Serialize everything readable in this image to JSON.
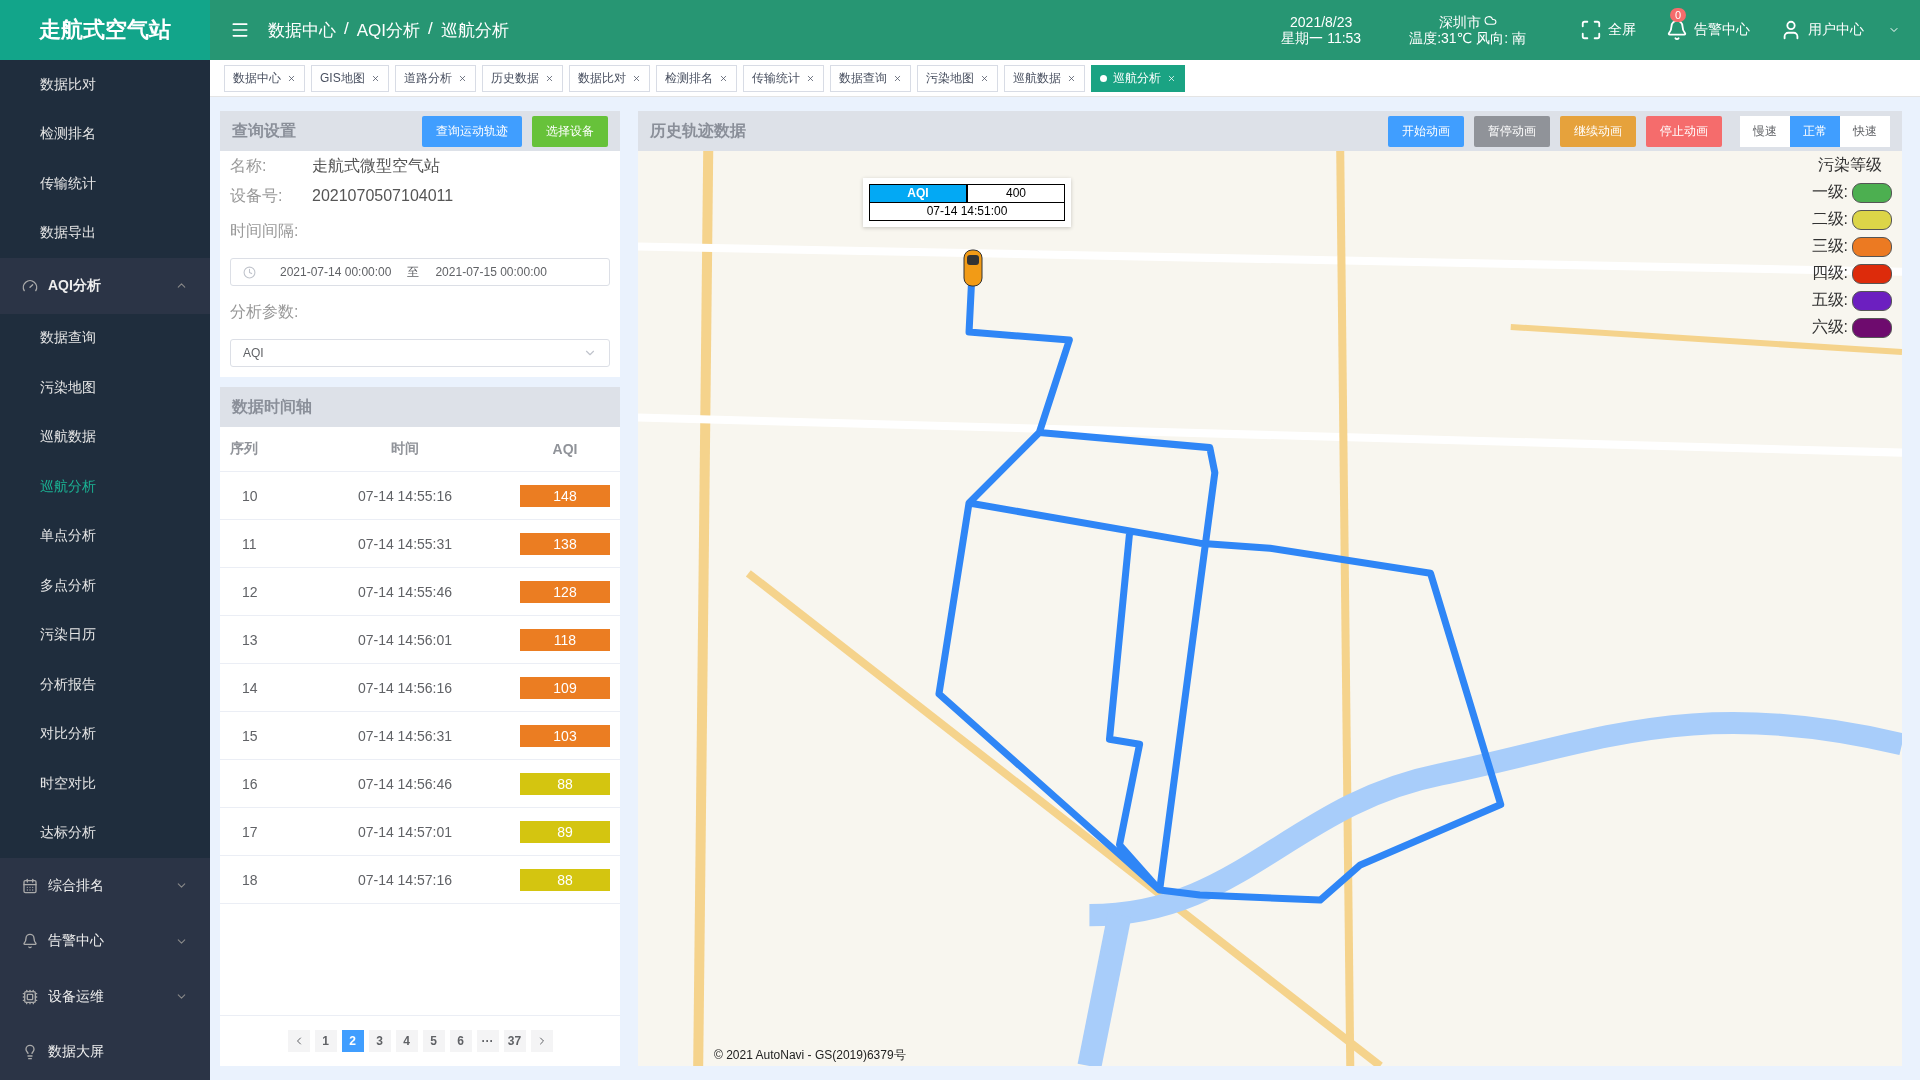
{
  "app_title": "走航式空气站",
  "breadcrumb": [
    {
      "label": "数据中心"
    },
    {
      "separator": "/",
      "label": "AQI分析"
    },
    {
      "separator": "/",
      "label": "巡航分析"
    }
  ],
  "datetime": {
    "date": "2021/8/23",
    "weekday_time": "星期一 11:53"
  },
  "weather": {
    "city": "深圳市",
    "detail": "温度:31℃ 风向: 南"
  },
  "header_actions": [
    {
      "kind": "fullscreen",
      "label": "全屏"
    },
    {
      "kind": "alarm",
      "label": "告警中心",
      "badge": "0"
    },
    {
      "kind": "user",
      "label": "用户中心"
    }
  ],
  "tabs": [
    {
      "label": "数据中心",
      "selected": false
    },
    {
      "label": "GIS地图",
      "selected": false
    },
    {
      "label": "道路分析",
      "selected": false
    },
    {
      "label": "历史数据",
      "selected": false
    },
    {
      "label": "数据比对",
      "selected": false
    },
    {
      "label": "检测排名",
      "selected": false
    },
    {
      "label": "传输统计",
      "selected": false
    },
    {
      "label": "数据查询",
      "selected": false
    },
    {
      "label": "污染地图",
      "selected": false
    },
    {
      "label": "巡航数据",
      "selected": false
    },
    {
      "label": "巡航分析",
      "selected": true
    }
  ],
  "sidebar": {
    "items": [
      {
        "label": "数据比对",
        "selected": false
      },
      {
        "label": "检测排名",
        "selected": false
      },
      {
        "label": "传输统计",
        "selected": false
      },
      {
        "label": "数据导出",
        "selected": false
      }
    ],
    "groups": [
      {
        "label": "AQI分析",
        "expanded": true,
        "children": [
          {
            "label": "数据查询",
            "selected": false
          },
          {
            "label": "污染地图",
            "selected": false
          },
          {
            "label": "巡航数据",
            "selected": false
          },
          {
            "label": "巡航分析",
            "selected": true
          },
          {
            "label": "单点分析",
            "selected": false
          },
          {
            "label": "多点分析",
            "selected": false
          },
          {
            "label": "污染日历",
            "selected": false
          },
          {
            "label": "分析报告",
            "selected": false
          },
          {
            "label": "对比分析",
            "selected": false
          },
          {
            "label": "时空对比",
            "selected": false
          },
          {
            "label": "达标分析",
            "selected": false
          }
        ]
      },
      {
        "label": "综合排名",
        "expanded": false
      },
      {
        "label": "告警中心",
        "expanded": false
      },
      {
        "label": "设备运维",
        "expanded": false
      },
      {
        "label": "数据大屏"
      }
    ]
  },
  "query": {
    "title": "查询设置",
    "buttons": [
      {
        "label": "查询运动轨迹",
        "color": "#409eff"
      },
      {
        "label": "选择设备",
        "color": "#67c23a"
      }
    ],
    "fields": [
      {
        "label": "名称:",
        "value": "走航式微型空气站"
      },
      {
        "label": "设备号:",
        "value": "2021070507104011"
      }
    ],
    "interval_label": "时间间隔:",
    "start": "2021-07-14 00:00:00",
    "separator": "至",
    "end": "2021-07-15 00:00:00",
    "param_label": "分析参数:",
    "param_value": "AQI"
  },
  "timeline": {
    "title": "数据时间轴",
    "columns": [
      "序列",
      "时间",
      "AQI"
    ],
    "rows": [
      {
        "index": "10",
        "time": "07-14 14:55:16",
        "aqi": "148",
        "color": "#eb7d22"
      },
      {
        "index": "11",
        "time": "07-14 14:55:31",
        "aqi": "138",
        "color": "#eb7d22"
      },
      {
        "index": "12",
        "time": "07-14 14:55:46",
        "aqi": "128",
        "color": "#eb7d22"
      },
      {
        "index": "13",
        "time": "07-14 14:56:01",
        "aqi": "118",
        "color": "#eb7d22"
      },
      {
        "index": "14",
        "time": "07-14 14:56:16",
        "aqi": "109",
        "color": "#eb7d22"
      },
      {
        "index": "15",
        "time": "07-14 14:56:31",
        "aqi": "103",
        "color": "#eb7d22"
      },
      {
        "index": "16",
        "time": "07-14 14:56:46",
        "aqi": "88",
        "color": "#d4c510"
      },
      {
        "index": "17",
        "time": "07-14 14:57:01",
        "aqi": "89",
        "color": "#d4c510"
      },
      {
        "index": "18",
        "time": "07-14 14:57:16",
        "aqi": "88",
        "color": "#d4c510"
      }
    ],
    "pages": [
      {
        "label": "1",
        "selected": false
      },
      {
        "label": "2",
        "selected": true
      },
      {
        "label": "3",
        "selected": false
      },
      {
        "label": "4",
        "selected": false
      },
      {
        "label": "5",
        "selected": false
      },
      {
        "label": "6",
        "selected": false
      },
      {
        "label": "···",
        "selected": false
      },
      {
        "label": "37",
        "selected": false
      }
    ]
  },
  "history": {
    "title": "历史轨迹数据",
    "buttons": [
      {
        "label": "开始动画",
        "color": "#409eff"
      },
      {
        "label": "暂停动画",
        "color": "#909399"
      },
      {
        "label": "继续动画",
        "color": "#e6a23c"
      },
      {
        "label": "停止动画",
        "color": "#f56c6c"
      }
    ],
    "speeds": [
      {
        "label": "慢速",
        "selected": false
      },
      {
        "label": "正常",
        "selected": true
      },
      {
        "label": "快速",
        "selected": false
      }
    ],
    "popup": {
      "name": "AQI",
      "value": "400",
      "time": "07-14 14:51:00"
    },
    "legend": {
      "title": "污染等级",
      "levels": [
        {
          "label": "一级:",
          "color": "#4caf50"
        },
        {
          "label": "二级:",
          "color": "#dcd548"
        },
        {
          "label": "三级:",
          "color": "#ec7a22"
        },
        {
          "label": "四级:",
          "color": "#dd2b0b"
        },
        {
          "label": "五级:",
          "color": "#6c1fc0"
        },
        {
          "label": "六级:",
          "color": "#6e0b6e"
        }
      ]
    },
    "copyright": "© 2021 AutoNavi - GS(2019)6379号"
  }
}
